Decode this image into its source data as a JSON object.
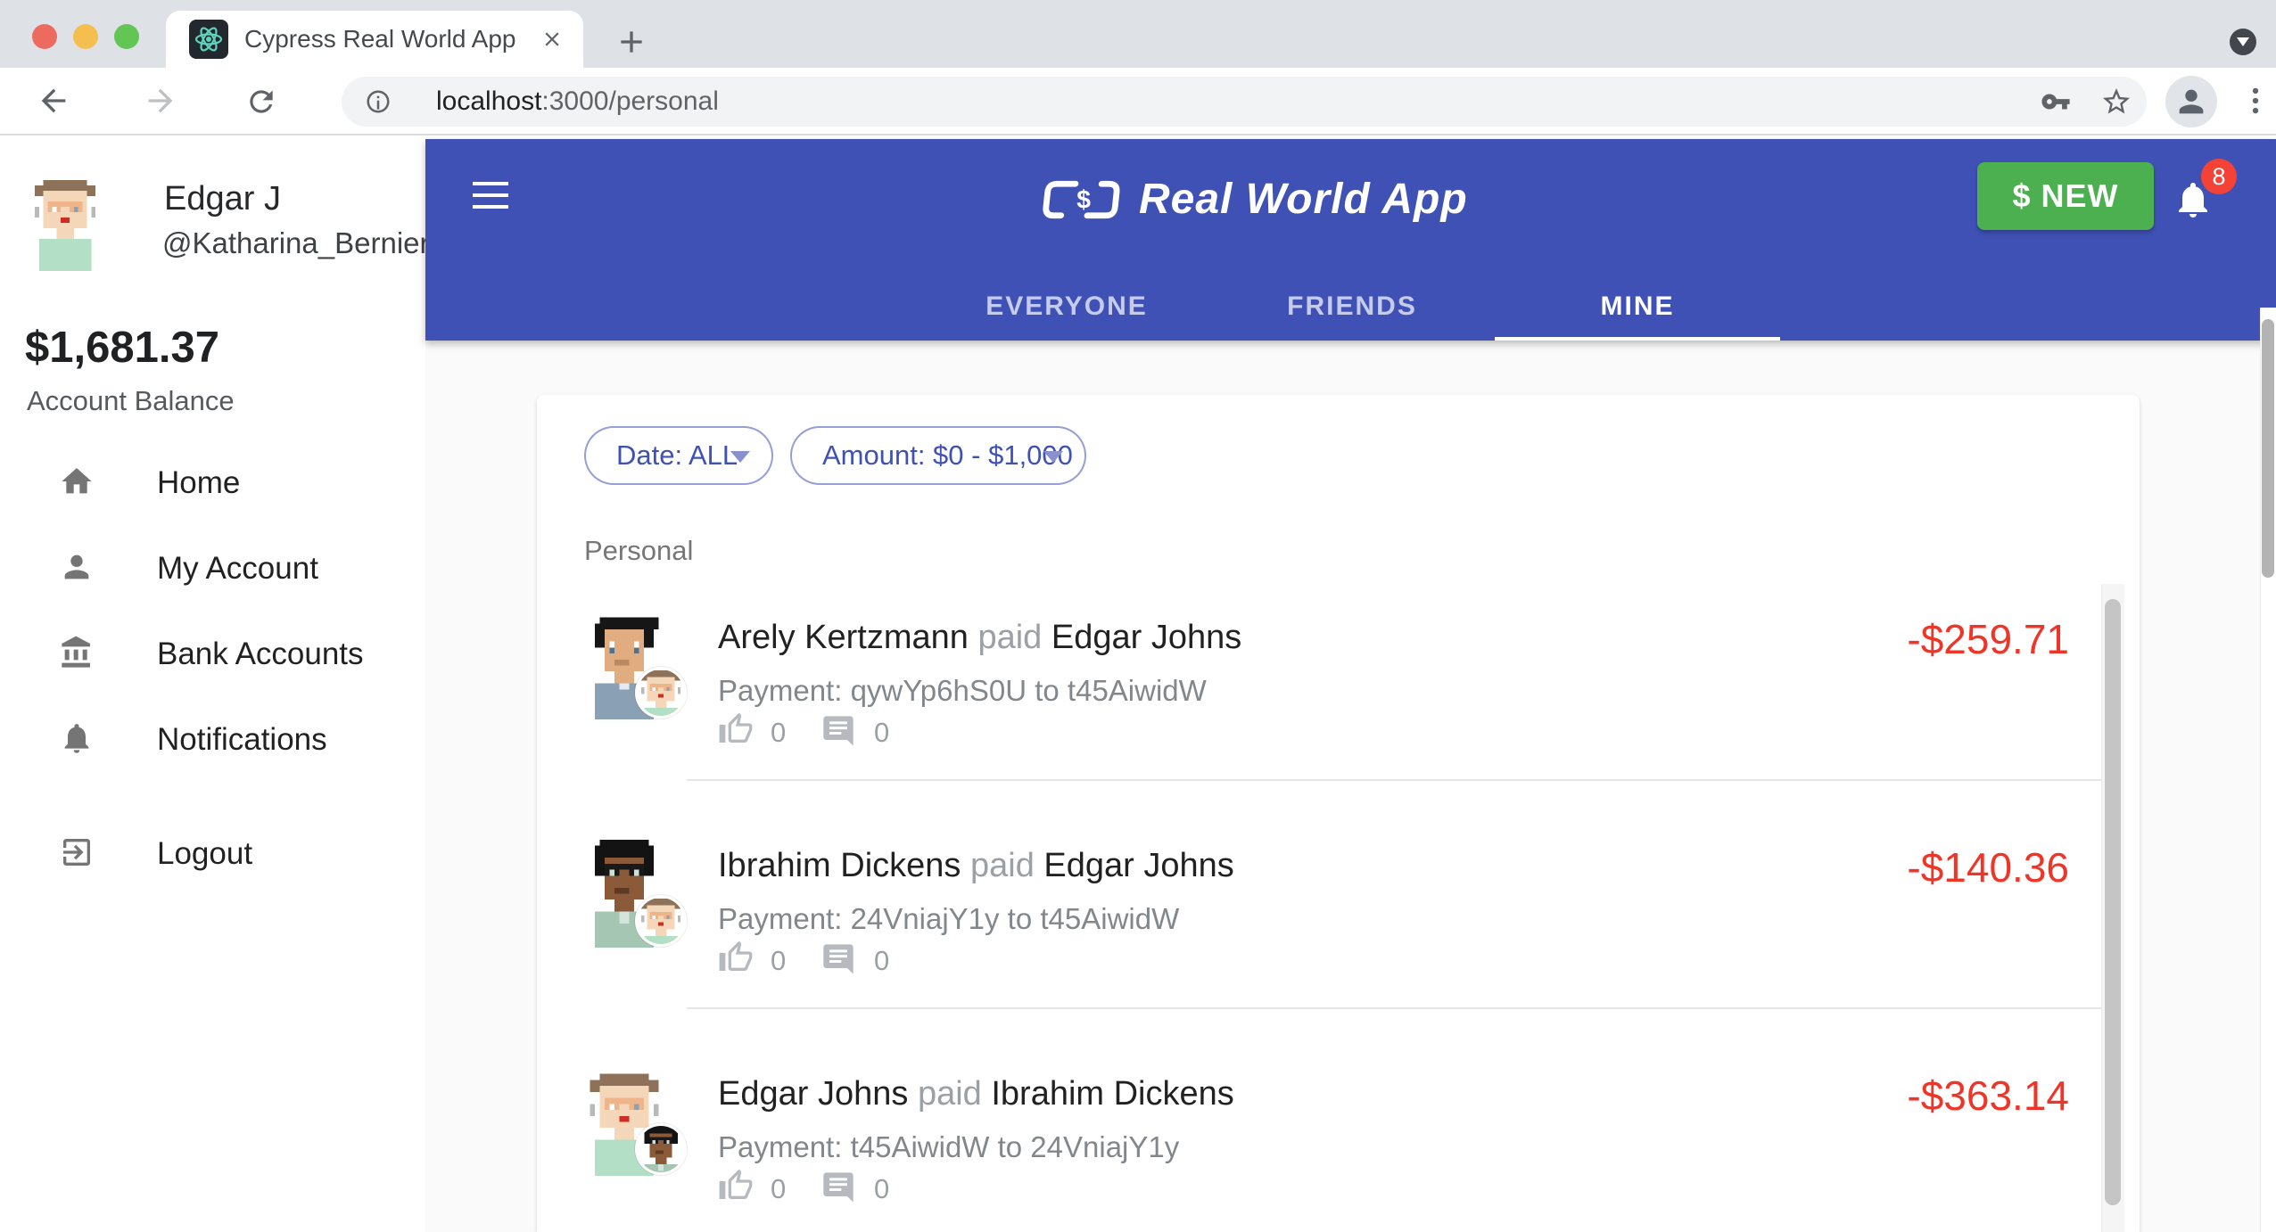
{
  "browser": {
    "tab_title": "Cypress Real World App",
    "url": {
      "host": "localhost",
      "path": ":3000/personal"
    }
  },
  "app_header": {
    "title": "Real World App",
    "new_button_label": "$ NEW",
    "notification_badge": "8",
    "tabs": [
      {
        "label": "EVERYONE",
        "active": false
      },
      {
        "label": "FRIENDS",
        "active": false
      },
      {
        "label": "MINE",
        "active": true
      }
    ]
  },
  "sidebar": {
    "user_name": "Edgar J",
    "user_handle": "@Katharina_Bernier",
    "balance": "$1,681.37",
    "balance_label": "Account Balance",
    "nav": [
      {
        "label": "Home"
      },
      {
        "label": "My Account"
      },
      {
        "label": "Bank Accounts"
      },
      {
        "label": "Notifications"
      },
      {
        "label": "Logout"
      }
    ]
  },
  "filters": {
    "date_label": "Date: ALL",
    "amount_label": "Amount: $0 - $1,000"
  },
  "transactions": {
    "group_label": "Personal",
    "items": [
      {
        "sender": "Arely Kertzmann",
        "action": "paid",
        "receiver": "Edgar Johns",
        "description": "Payment: qywYp6hS0U to t45AiwidW",
        "likes": "0",
        "comments": "0",
        "amount": "-$259.71"
      },
      {
        "sender": "Ibrahim Dickens",
        "action": "paid",
        "receiver": "Edgar Johns",
        "description": "Payment: 24VniajY1y to t45AiwidW",
        "likes": "0",
        "comments": "0",
        "amount": "-$140.36"
      },
      {
        "sender": "Edgar Johns",
        "action": "paid",
        "receiver": "Ibrahim Dickens",
        "description": "Payment: t45AiwidW to 24VniajY1y",
        "likes": "0",
        "comments": "0",
        "amount": "-$363.14"
      }
    ]
  },
  "colors": {
    "header_blue": "#3f51b5",
    "button_green": "#4caf50",
    "badge_red": "#f44336",
    "amount_red": "#ef3528",
    "chip_indigo": "#3f51b5"
  }
}
